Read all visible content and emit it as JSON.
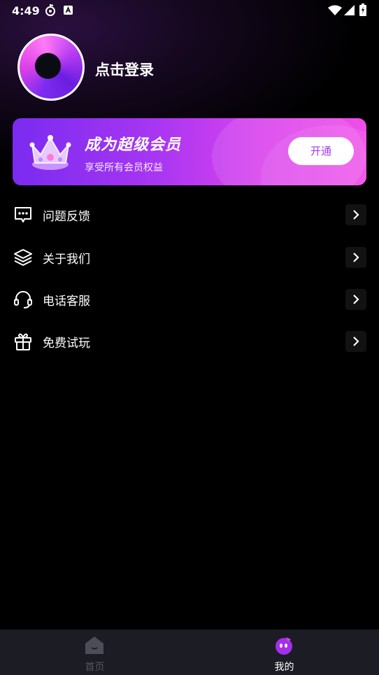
{
  "status_bar": {
    "time": "4:49",
    "icons": [
      "music-notification-icon",
      "app-notification-icon",
      "wifi-icon",
      "signal-icon",
      "battery-icon"
    ]
  },
  "profile": {
    "login_text": "点击登录",
    "avatar_icon": "app-logo-icon"
  },
  "vip": {
    "title": "成为超级会员",
    "subtitle": "享受所有会员权益",
    "button_label": "开通",
    "icon": "crown-icon",
    "colors": {
      "start": "#7a2bf0",
      "end": "#f04ee9",
      "button_text": "#a43bf0"
    }
  },
  "menu": {
    "items": [
      {
        "label": "问题反馈",
        "icon": "chat-feedback-icon"
      },
      {
        "label": "关于我们",
        "icon": "layers-icon"
      },
      {
        "label": "电话客服",
        "icon": "headset-icon"
      },
      {
        "label": "免费试玩",
        "icon": "gift-icon"
      }
    ]
  },
  "bottom_nav": {
    "tabs": [
      {
        "label": "首页",
        "icon": "home-icon",
        "active": false,
        "color": "#555560"
      },
      {
        "label": "我的",
        "icon": "mascot-icon",
        "active": true,
        "color": "#ffffff"
      }
    ]
  }
}
